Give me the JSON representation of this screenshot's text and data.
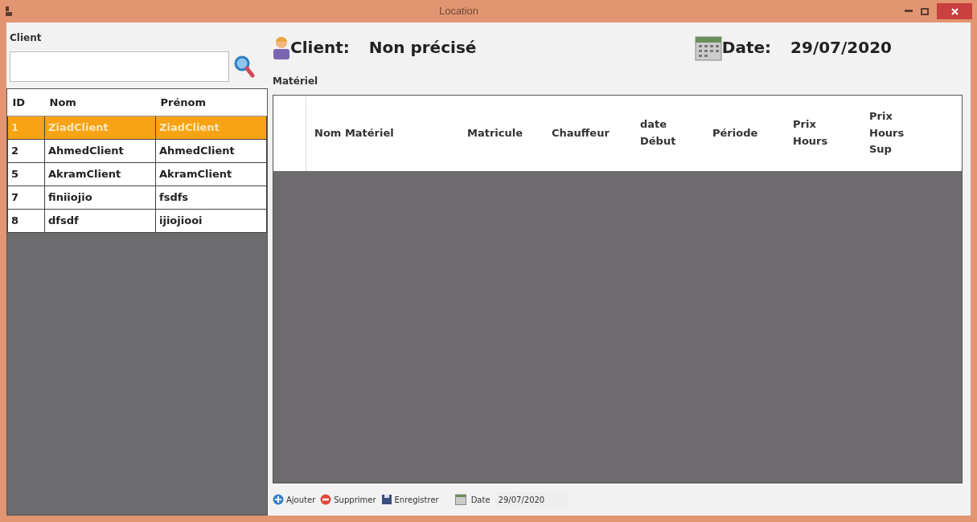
{
  "window": {
    "title": "Location"
  },
  "client_panel": {
    "legend": "Client",
    "columns": [
      "ID",
      "Nom",
      "Prénom"
    ],
    "rows": [
      {
        "cells": [
          "1",
          "ZiadClient",
          "ZiadClient"
        ],
        "selected": true
      },
      {
        "cells": [
          "2",
          "AhmedClient",
          "AhmedClient"
        ],
        "selected": false
      },
      {
        "cells": [
          "5",
          "AkramClient",
          "AkramClient"
        ],
        "selected": false
      },
      {
        "cells": [
          "7",
          "finiiojio",
          "fsdfs"
        ],
        "selected": false
      },
      {
        "cells": [
          "8",
          "dfsdf",
          "ijiojiooi"
        ],
        "selected": false
      }
    ]
  },
  "header": {
    "client_label": "Client:",
    "client_value": "Non précisé",
    "date_label": "Date:",
    "date_value": "29/07/2020"
  },
  "materiel": {
    "legend": "Matériel",
    "columns": [
      "Nom Matériel",
      "Matricule",
      "Chauffeur",
      "date Début",
      "Période",
      "Prix Hours",
      "Prix Hours Sup"
    ]
  },
  "toolbar": {
    "buttons": [
      {
        "kind": "add",
        "label": "Ajouter"
      },
      {
        "kind": "delete",
        "label": "Supprimer"
      },
      {
        "kind": "save",
        "label": "Enregistrer"
      }
    ],
    "date_label": "Date",
    "date_value": "29/07/2020"
  }
}
